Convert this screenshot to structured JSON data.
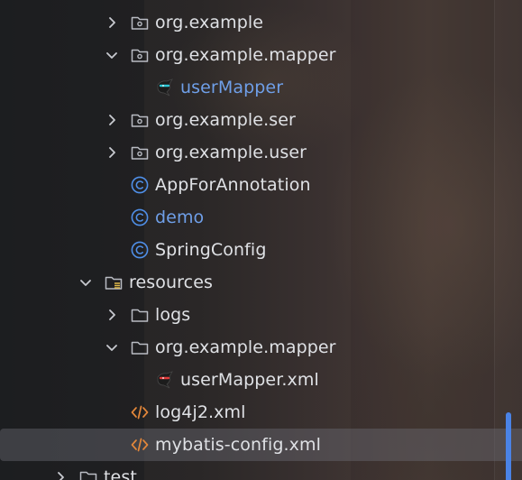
{
  "tree": {
    "items": [
      {
        "label": "org.example"
      },
      {
        "label": "org.example.mapper"
      },
      {
        "label": "userMapper"
      },
      {
        "label": "org.example.ser"
      },
      {
        "label": "org.example.user"
      },
      {
        "label": "AppForAnnotation"
      },
      {
        "label": "demo"
      },
      {
        "label": "SpringConfig"
      },
      {
        "label": "resources"
      },
      {
        "label": "logs"
      },
      {
        "label": "org.example.mapper"
      },
      {
        "label": "userMapper.xml"
      },
      {
        "label": "log4j2.xml"
      },
      {
        "label": "mybatis-config.xml"
      },
      {
        "label": "test"
      }
    ]
  },
  "icons": {
    "package": "package-folder-icon",
    "folder": "folder-icon",
    "resources_folder": "resources-folder-icon",
    "java_class": "java-class-icon",
    "mybatis": "mybatis-bird-icon",
    "xml": "xml-file-icon",
    "chevron_right": "chevron-right-icon",
    "chevron_down": "chevron-down-icon"
  },
  "colors": {
    "text": "#dfe1e5",
    "modified_text": "#6f9fe8",
    "class_icon": "#4f8fe8",
    "xml_icon": "#e3873a",
    "selection": "#5a5a62",
    "scrollbar": "#4a83e6"
  }
}
